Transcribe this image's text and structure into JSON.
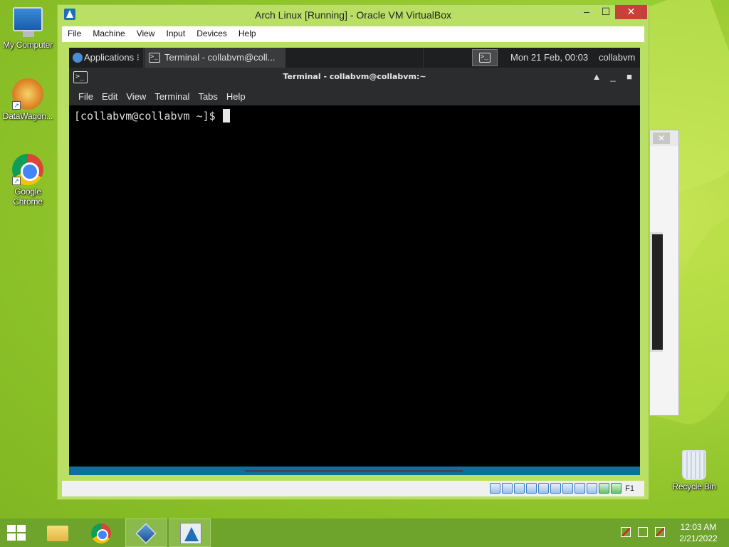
{
  "desktop": {
    "icons": [
      {
        "label": "My Computer"
      },
      {
        "label": "DataWagon..."
      },
      {
        "label": "Google Chrome"
      },
      {
        "label": "Recycle Bin"
      }
    ]
  },
  "vbox": {
    "title": "Arch Linux [Running] - Oracle VM VirtualBox",
    "menu": [
      "File",
      "Machine",
      "View",
      "Input",
      "Devices",
      "Help"
    ],
    "window_buttons": {
      "minimize": "–",
      "maximize": "☐",
      "close": "✕"
    },
    "status": {
      "host_key": "F1"
    }
  },
  "guest_panel": {
    "applications_label": "Applications",
    "applications_arrow": "⁝",
    "task_label": "Terminal - collabvm@coll...",
    "clock": "Mon 21 Feb, 00:03",
    "user": "collabvm"
  },
  "terminal": {
    "title": "Terminal - collabvm@collabvm:~",
    "icon_glyph": ">_",
    "menu": [
      "File",
      "Edit",
      "View",
      "Terminal",
      "Tabs",
      "Help"
    ],
    "prompt": "[collabvm@collabvm ~]$",
    "buttons": {
      "up": "▲",
      "min": "_",
      "max": "■"
    }
  },
  "bg_window": {
    "close": "✕"
  },
  "taskbar": {
    "clock_time": "12:03 AM",
    "clock_date": "2/21/2022"
  },
  "colors": {
    "desktop_green": "#8fc42a",
    "taskbar": "#6ea32c",
    "terminal_bg": "#000000",
    "panel": "#1e1f21",
    "close_red": "#c7403a"
  }
}
